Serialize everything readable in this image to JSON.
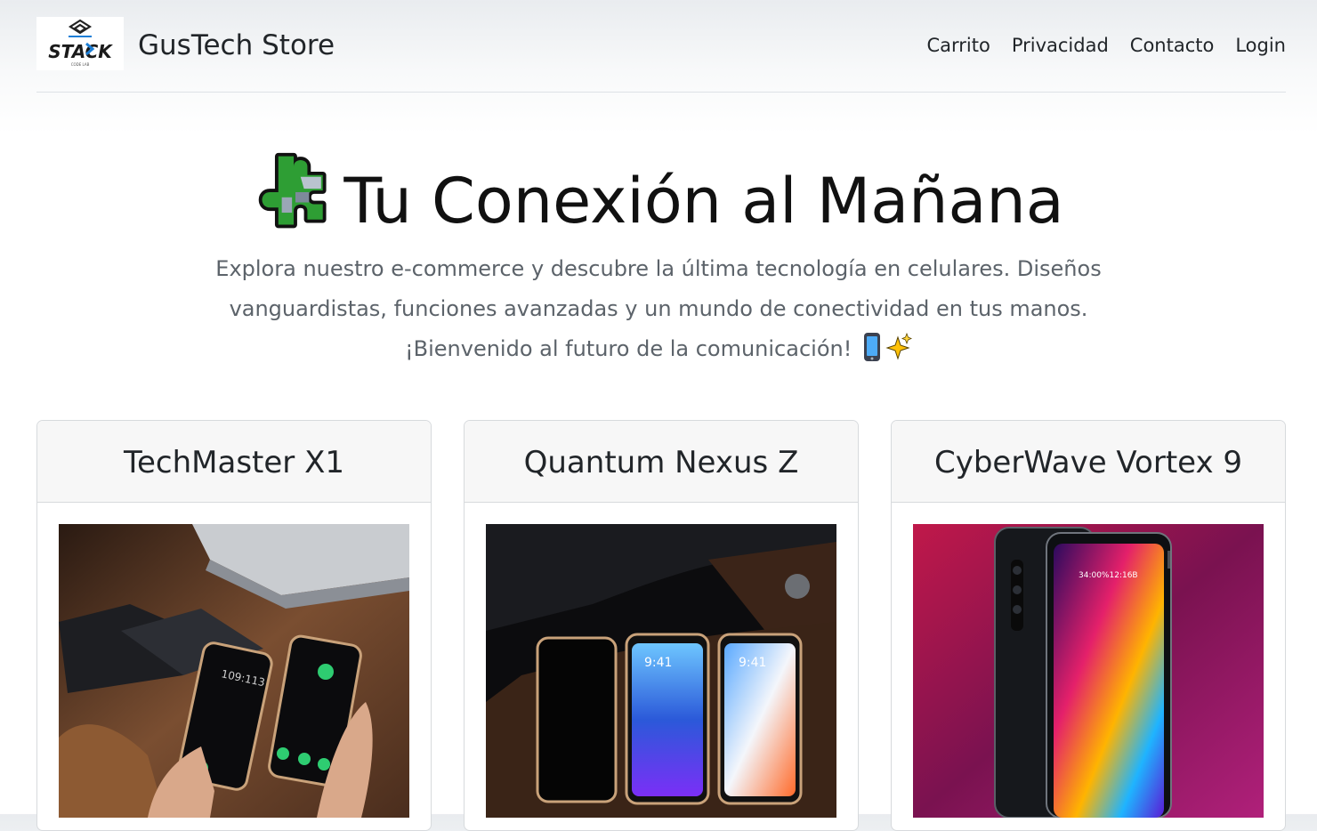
{
  "header": {
    "logo_text": "STACK",
    "logo_subtext": "CODE LAB",
    "brand": "GusTech Store",
    "nav": [
      "Carrito",
      "Privacidad",
      "Contacto",
      "Login"
    ]
  },
  "hero": {
    "title": "Tu Conexión al Mañana",
    "lead": "Explora nuestro e-commerce y descubre la última tecnología en celulares. Diseños vanguardistas, funciones avanzadas y un mundo de conectividad en tus manos. ¡Bienvenido al futuro de la comunicación!"
  },
  "products": [
    {
      "name": "TechMaster X1",
      "screen_text_1": "109:113"
    },
    {
      "name": "Quantum Nexus Z",
      "screen_text_1": "9:41",
      "screen_text_2": "9:41"
    },
    {
      "name": "CyberWave Vortex 9",
      "screen_text_1": "34:00%12:16B"
    }
  ],
  "colors": {
    "header_bg": "#e9ecef",
    "text": "#212529",
    "muted": "#5c636a",
    "card_header_bg": "#f7f7f7",
    "puzzle_green": "#2e9e34"
  }
}
